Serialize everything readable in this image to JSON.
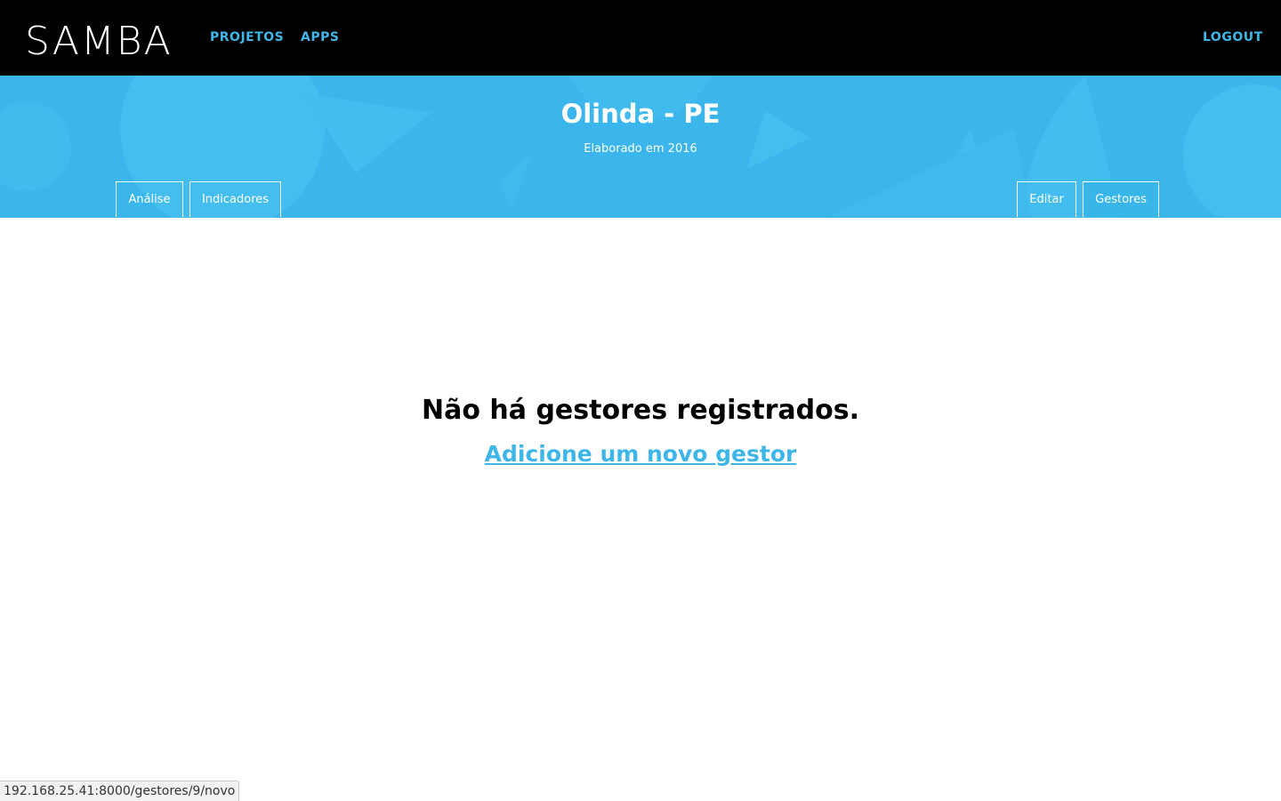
{
  "colors": {
    "topbar_bg": "#000000",
    "accent": "#3fb6e8",
    "hero_bg": "#3ab6ec",
    "text_dark": "#000000",
    "text_light": "#ffffff"
  },
  "topbar": {
    "logo": "SAMBA",
    "nav": [
      {
        "label": "PROJETOS"
      },
      {
        "label": "APPS"
      }
    ],
    "logout_label": "LOGOUT"
  },
  "hero": {
    "title": "Olinda - PE",
    "subtitle": "Elaborado em 2016",
    "tabs_left": [
      {
        "label": "Análise"
      },
      {
        "label": "Indicadores"
      }
    ],
    "tabs_right": [
      {
        "label": "Editar"
      },
      {
        "label": "Gestores",
        "active": true
      }
    ]
  },
  "main": {
    "empty_message": "Não há gestores registrados.",
    "add_link_label": "Adicione um novo gestor"
  },
  "status_url": "192.168.25.41:8000/gestores/9/novo"
}
